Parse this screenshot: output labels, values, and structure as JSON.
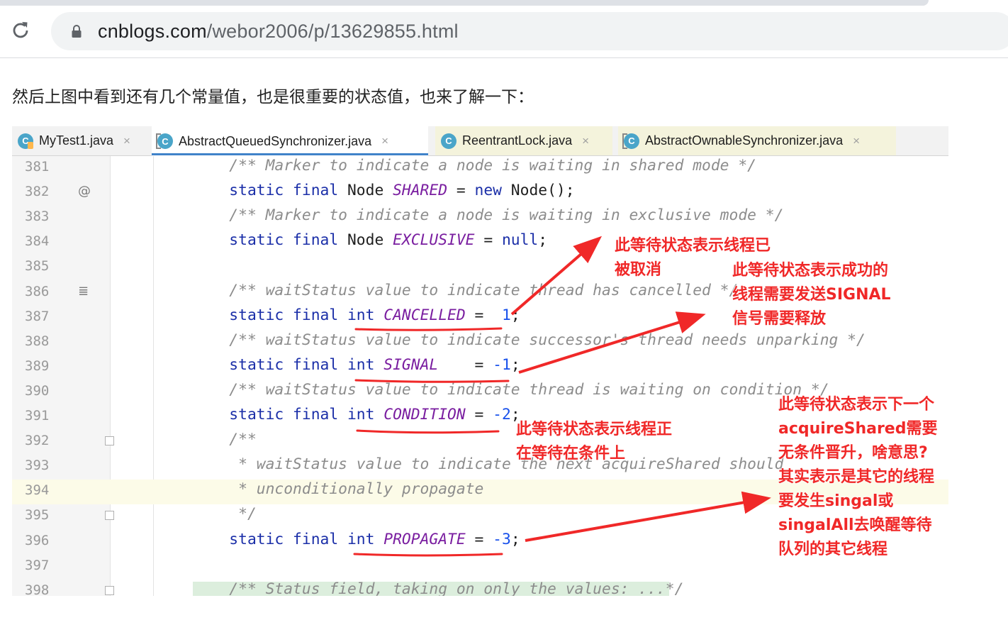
{
  "browser": {
    "url_host": "cnblogs.com",
    "url_path": "/webor2006/p/13629855.html",
    "reload_icon": "reload-icon",
    "lock_icon": "lock-icon"
  },
  "article": {
    "paragraph": "然后上图中看到还有几个常量值，也是很重要的状态值，也来了解一下："
  },
  "ide": {
    "tabs": [
      {
        "label": "MyTest1.java",
        "icon": "java-class-icon"
      },
      {
        "label": "AbstractQueuedSynchronizer.java",
        "icon": "library-class-icon"
      },
      {
        "label": "ReentrantLock.java",
        "icon": "class-icon"
      },
      {
        "label": "AbstractOwnableSynchronizer.java",
        "icon": "library-class-icon"
      }
    ],
    "close_glyph": "×",
    "lines": [
      {
        "n": "381",
        "code": [
          {
            "t": "    "
          },
          {
            "c": "cm",
            "t": "/** Marker to indicate a node is waiting in shared mode */"
          }
        ]
      },
      {
        "n": "382",
        "code": [
          {
            "t": "    "
          },
          {
            "c": "kw",
            "t": "static final "
          },
          {
            "t": "Node "
          },
          {
            "c": "fld",
            "t": "SHARED"
          },
          {
            "t": " = "
          },
          {
            "c": "kw",
            "t": "new "
          },
          {
            "t": "Node();"
          }
        ]
      },
      {
        "n": "383",
        "code": [
          {
            "t": "    "
          },
          {
            "c": "cm",
            "t": "/** Marker to indicate a node is waiting in exclusive mode */"
          }
        ]
      },
      {
        "n": "384",
        "code": [
          {
            "t": "    "
          },
          {
            "c": "kw",
            "t": "static final "
          },
          {
            "t": "Node "
          },
          {
            "c": "fld",
            "t": "EXCLUSIVE"
          },
          {
            "t": " = "
          },
          {
            "c": "kw",
            "t": "null"
          },
          {
            "t": ";"
          }
        ]
      },
      {
        "n": "385",
        "code": []
      },
      {
        "n": "386",
        "code": [
          {
            "t": "    "
          },
          {
            "c": "cm",
            "t": "/** waitStatus value to indicate thread has cancelled */"
          }
        ]
      },
      {
        "n": "387",
        "code": [
          {
            "t": "    "
          },
          {
            "c": "kw",
            "t": "static final int "
          },
          {
            "c": "fld",
            "t": "CANCELLED"
          },
          {
            "t": " =  "
          },
          {
            "c": "num",
            "t": "1"
          },
          {
            "t": ";"
          }
        ]
      },
      {
        "n": "388",
        "code": [
          {
            "t": "    "
          },
          {
            "c": "cm",
            "t": "/** waitStatus value to indicate successor's thread needs unparking */"
          }
        ]
      },
      {
        "n": "389",
        "code": [
          {
            "t": "    "
          },
          {
            "c": "kw",
            "t": "static final int "
          },
          {
            "c": "fld",
            "t": "SIGNAL"
          },
          {
            "t": "    = "
          },
          {
            "c": "num",
            "t": "-1"
          },
          {
            "t": ";"
          }
        ]
      },
      {
        "n": "390",
        "code": [
          {
            "t": "    "
          },
          {
            "c": "cm",
            "t": "/** waitStatus value to indicate thread is waiting on condition */"
          }
        ]
      },
      {
        "n": "391",
        "code": [
          {
            "t": "    "
          },
          {
            "c": "kw",
            "t": "static final int "
          },
          {
            "c": "fld",
            "t": "CONDITION"
          },
          {
            "t": " = "
          },
          {
            "c": "num",
            "t": "-2"
          },
          {
            "t": ";"
          }
        ]
      },
      {
        "n": "392",
        "code": [
          {
            "t": "    "
          },
          {
            "c": "cm",
            "t": "/**"
          }
        ]
      },
      {
        "n": "393",
        "code": [
          {
            "t": "    "
          },
          {
            "c": "cm",
            "t": " * waitStatus value to indicate the next acquireShared should"
          }
        ]
      },
      {
        "n": "394",
        "code": [
          {
            "t": "    "
          },
          {
            "c": "cm",
            "t": " * unconditionally propagate"
          }
        ]
      },
      {
        "n": "395",
        "code": [
          {
            "t": "    "
          },
          {
            "c": "cm",
            "t": " */"
          }
        ]
      },
      {
        "n": "396",
        "code": [
          {
            "t": "    "
          },
          {
            "c": "kw",
            "t": "static final int "
          },
          {
            "c": "fld",
            "t": "PROPAGATE"
          },
          {
            "t": " = "
          },
          {
            "c": "num",
            "t": "-3"
          },
          {
            "t": ";"
          }
        ]
      },
      {
        "n": "397",
        "code": []
      },
      {
        "n": "398",
        "code": [
          {
            "t": "    "
          },
          {
            "c": "cm",
            "t": "/** Status field, taking on only the values: ...*/"
          }
        ]
      }
    ],
    "gutter_icons": {
      "382": "@",
      "386": "≣"
    }
  },
  "annotations": {
    "note1": [
      "此等待状态表示线程已",
      "被取消"
    ],
    "note2": [
      "此等待状态表示成功的",
      "线程需要发送SIGNAL",
      "信号需要释放"
    ],
    "note3": [
      "此等待状态表示线程正",
      "在等待在条件上"
    ],
    "note4": [
      "此等待状态表示下一个",
      "acquireShared需要",
      "无条件晋升，啥意思?",
      "其实表示是其它的线程",
      "要发生singal或",
      "singalAll去唤醒等待",
      "队列的其它线程"
    ],
    "color": "#f02828"
  },
  "colors": {
    "keyword": "#1b2fa8",
    "field": "#7a1ea0",
    "number": "#1750eb",
    "comment": "#8c8c8c"
  }
}
